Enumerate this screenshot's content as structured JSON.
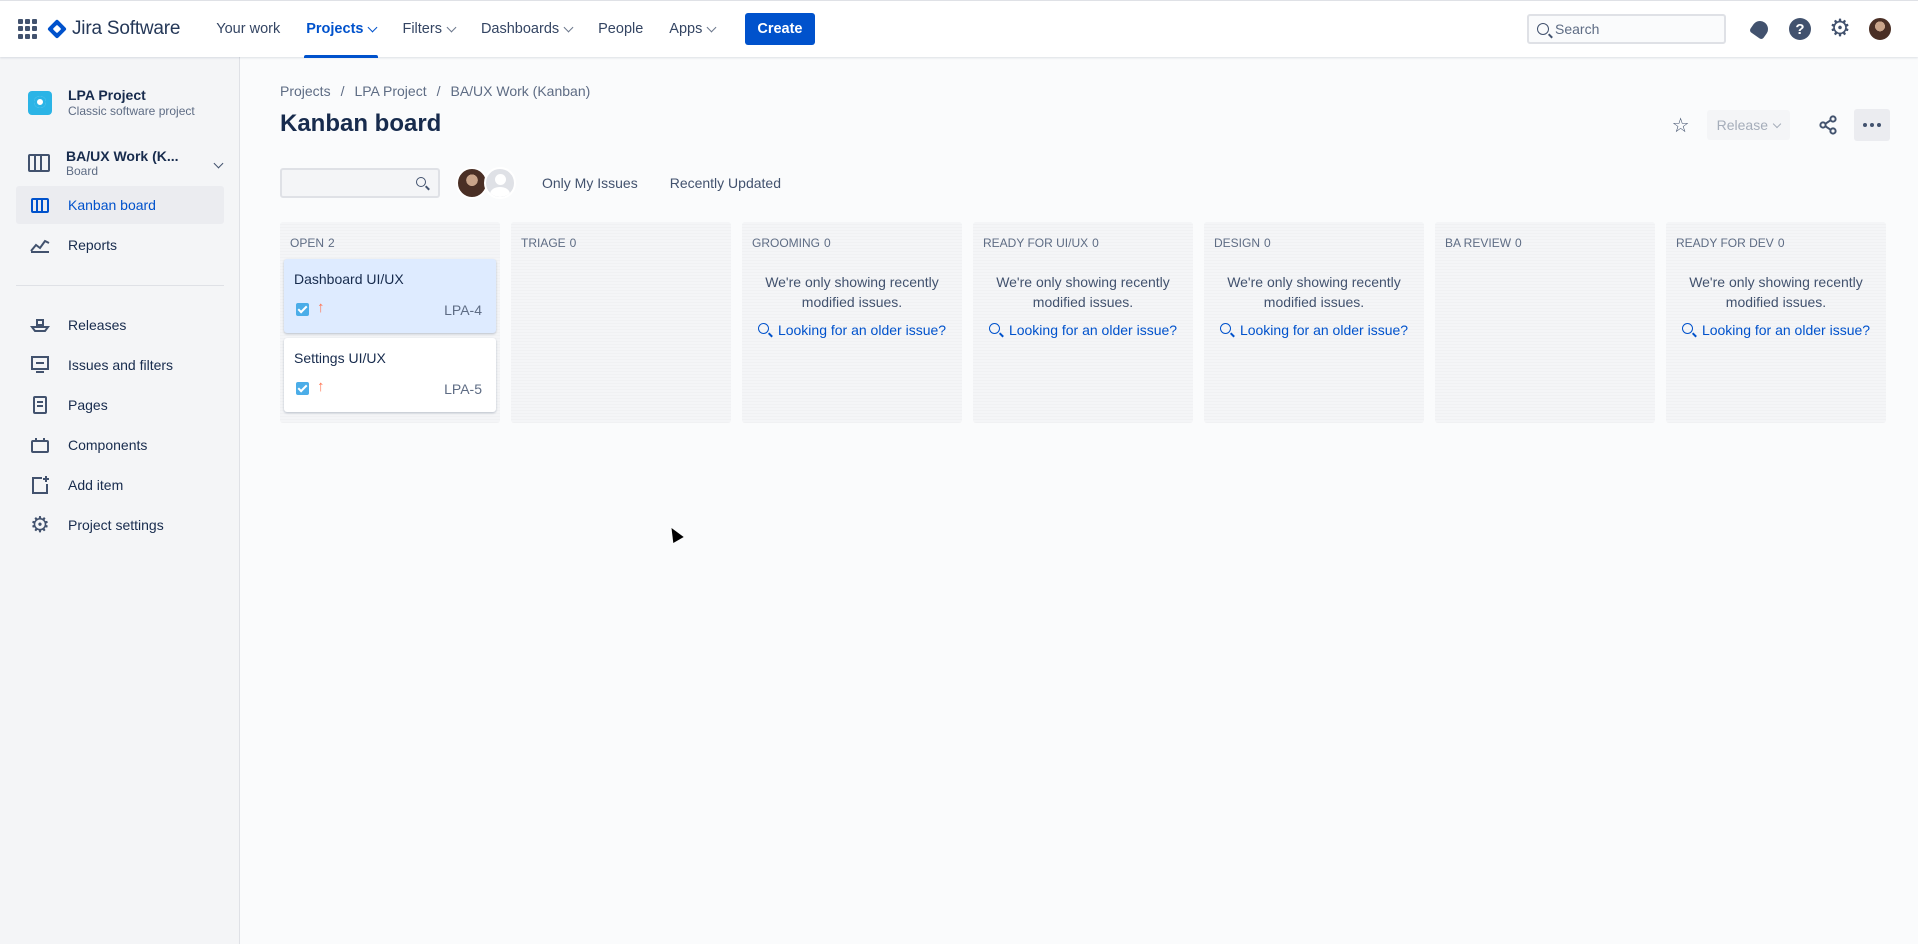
{
  "topnav": {
    "product": "Jira Software",
    "items": [
      {
        "label": "Your work",
        "dropdown": false
      },
      {
        "label": "Projects",
        "dropdown": true,
        "active": true
      },
      {
        "label": "Filters",
        "dropdown": true
      },
      {
        "label": "Dashboards",
        "dropdown": true
      },
      {
        "label": "People",
        "dropdown": false
      },
      {
        "label": "Apps",
        "dropdown": true
      }
    ],
    "create_label": "Create",
    "search_placeholder": "Search"
  },
  "sidebar": {
    "project_name": "LPA Project",
    "project_type": "Classic software project",
    "board_name": "BA/UX Work (K...",
    "board_sub": "Board",
    "items": [
      {
        "label": "Kanban board",
        "icon": "kanban-icon",
        "active": true
      },
      {
        "label": "Reports",
        "icon": "reports-icon"
      },
      {
        "label": "Releases",
        "icon": "releases-icon"
      },
      {
        "label": "Issues and filters",
        "icon": "issues-icon"
      },
      {
        "label": "Pages",
        "icon": "pages-icon"
      },
      {
        "label": "Components",
        "icon": "components-icon"
      },
      {
        "label": "Add item",
        "icon": "add-item-icon"
      },
      {
        "label": "Project settings",
        "icon": "settings-icon"
      }
    ]
  },
  "breadcrumb": [
    "Projects",
    "LPA Project",
    "BA/UX Work (Kanban)"
  ],
  "page_title": "Kanban board",
  "header": {
    "release_label": "Release"
  },
  "filters": {
    "only_my_issues": "Only My Issues",
    "recently_updated": "Recently Updated"
  },
  "board": {
    "empty_message_line1": "We're only showing recently",
    "empty_message_line2": "modified issues.",
    "older_link": "Looking for an older issue?",
    "columns": [
      {
        "name": "OPEN",
        "count": "2",
        "cards": [
          {
            "title": "Dashboard UI/UX",
            "key": "LPA-4",
            "selected": true
          },
          {
            "title": "Settings UI/UX",
            "key": "LPA-5",
            "selected": false
          }
        ]
      },
      {
        "name": "TRIAGE",
        "count": "0"
      },
      {
        "name": "GROOMING",
        "count": "0",
        "empty_note": true
      },
      {
        "name": "READY FOR UI/UX",
        "count": "0",
        "empty_note": true
      },
      {
        "name": "DESIGN",
        "count": "0",
        "empty_note": true
      },
      {
        "name": "BA REVIEW",
        "count": "0"
      },
      {
        "name": "READY FOR DEV",
        "count": "0",
        "empty_note": true
      }
    ]
  },
  "colors": {
    "brand": "#0052CC",
    "text": "#172B4D",
    "subtle": "#5E6C84",
    "priority": "#FF7452",
    "task": "#4BADE8"
  }
}
